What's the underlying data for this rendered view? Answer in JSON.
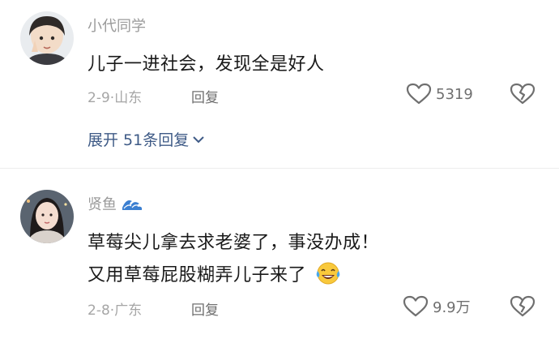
{
  "comments": [
    {
      "username": "小代同学",
      "text_lines": [
        "儿子一进社会，发现全是好人"
      ],
      "date": "2-9",
      "location": "山东",
      "reply_label": "回复",
      "likes": "5319",
      "expand_label": "展开 51条回复",
      "avatar_icon": "child-avatar"
    },
    {
      "username": "贤鱼",
      "username_emoji": "wave-emoji",
      "text_lines": [
        "草莓尖儿拿去求老婆了，事没办成！",
        "又用草莓屁股糊弄儿子来了"
      ],
      "date": "2-8",
      "location": "广东",
      "reply_label": "回复",
      "likes": "9.9万",
      "avatar_icon": "woman-avatar",
      "emoji_after_text": "laughing-tears-emoji"
    }
  ],
  "colors": {
    "username": "#9a9a9a",
    "text": "#1a1a1a",
    "meta": "#a6a6a6",
    "action": "#6f6f6f",
    "link": "#3e5a86"
  }
}
